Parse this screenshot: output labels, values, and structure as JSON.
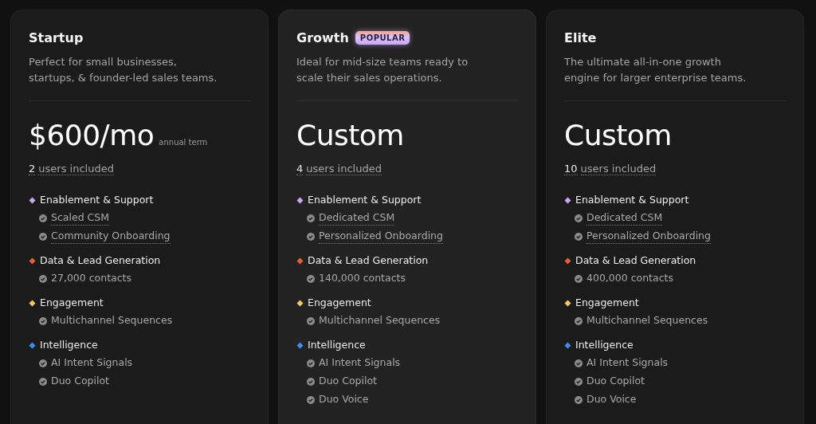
{
  "plans": [
    {
      "name": "Startup",
      "description": "Perfect for small businesses, startups, & founder-led sales teams.",
      "price": "$600/mo",
      "term": "annual term",
      "users_count": "2",
      "users_label": "users included",
      "groups": [
        {
          "title": "Enablement & Support",
          "color": "#c9a7f5",
          "items": [
            {
              "text": "Scaled CSM",
              "underlined": true
            },
            {
              "text": "Community Onboarding",
              "underlined": true
            }
          ]
        },
        {
          "title": "Data & Lead Generation",
          "color": "#e5603a",
          "items": [
            {
              "text": "27,000 contacts",
              "underlined": false
            }
          ]
        },
        {
          "title": "Engagement",
          "color": "#f7c46a",
          "items": [
            {
              "text": "Multichannel Sequences",
              "underlined": false
            }
          ]
        },
        {
          "title": "Intelligence",
          "color": "#3d8ef0",
          "items": [
            {
              "text": "AI Intent Signals",
              "underlined": false
            },
            {
              "text": "Duo Copilot",
              "underlined": false
            }
          ]
        }
      ]
    },
    {
      "name": "Growth",
      "badge": "POPULAR",
      "description": "Ideal for mid-size teams ready to scale their sales operations.",
      "price": "Custom",
      "users_count": "4",
      "users_label": "users included",
      "groups": [
        {
          "title": "Enablement & Support",
          "color": "#c9a7f5",
          "items": [
            {
              "text": "Dedicated CSM",
              "underlined": true
            },
            {
              "text": "Personalized Onboarding",
              "underlined": true
            }
          ]
        },
        {
          "title": "Data & Lead Generation",
          "color": "#e5603a",
          "items": [
            {
              "text": "140,000 contacts",
              "underlined": false
            }
          ]
        },
        {
          "title": "Engagement",
          "color": "#f7c46a",
          "items": [
            {
              "text": "Multichannel Sequences",
              "underlined": false
            }
          ]
        },
        {
          "title": "Intelligence",
          "color": "#3d8ef0",
          "items": [
            {
              "text": "AI Intent Signals",
              "underlined": false
            },
            {
              "text": "Duo Copilot",
              "underlined": false
            },
            {
              "text": "Duo Voice",
              "underlined": false
            }
          ]
        }
      ]
    },
    {
      "name": "Elite",
      "description": "The ultimate all-in-one growth engine for larger enterprise teams.",
      "price": "Custom",
      "users_count": "10",
      "users_label": "users included",
      "groups": [
        {
          "title": "Enablement & Support",
          "color": "#c9a7f5",
          "items": [
            {
              "text": "Dedicated CSM",
              "underlined": true
            },
            {
              "text": "Personalized Onboarding",
              "underlined": true
            }
          ]
        },
        {
          "title": "Data & Lead Generation",
          "color": "#e5603a",
          "items": [
            {
              "text": "400,000 contacts",
              "underlined": false
            }
          ]
        },
        {
          "title": "Engagement",
          "color": "#f7c46a",
          "items": [
            {
              "text": "Multichannel Sequences",
              "underlined": false
            }
          ]
        },
        {
          "title": "Intelligence",
          "color": "#3d8ef0",
          "items": [
            {
              "text": "AI Intent Signals",
              "underlined": false
            },
            {
              "text": "Duo Copilot",
              "underlined": false
            },
            {
              "text": "Duo Voice",
              "underlined": false
            }
          ]
        }
      ]
    }
  ]
}
